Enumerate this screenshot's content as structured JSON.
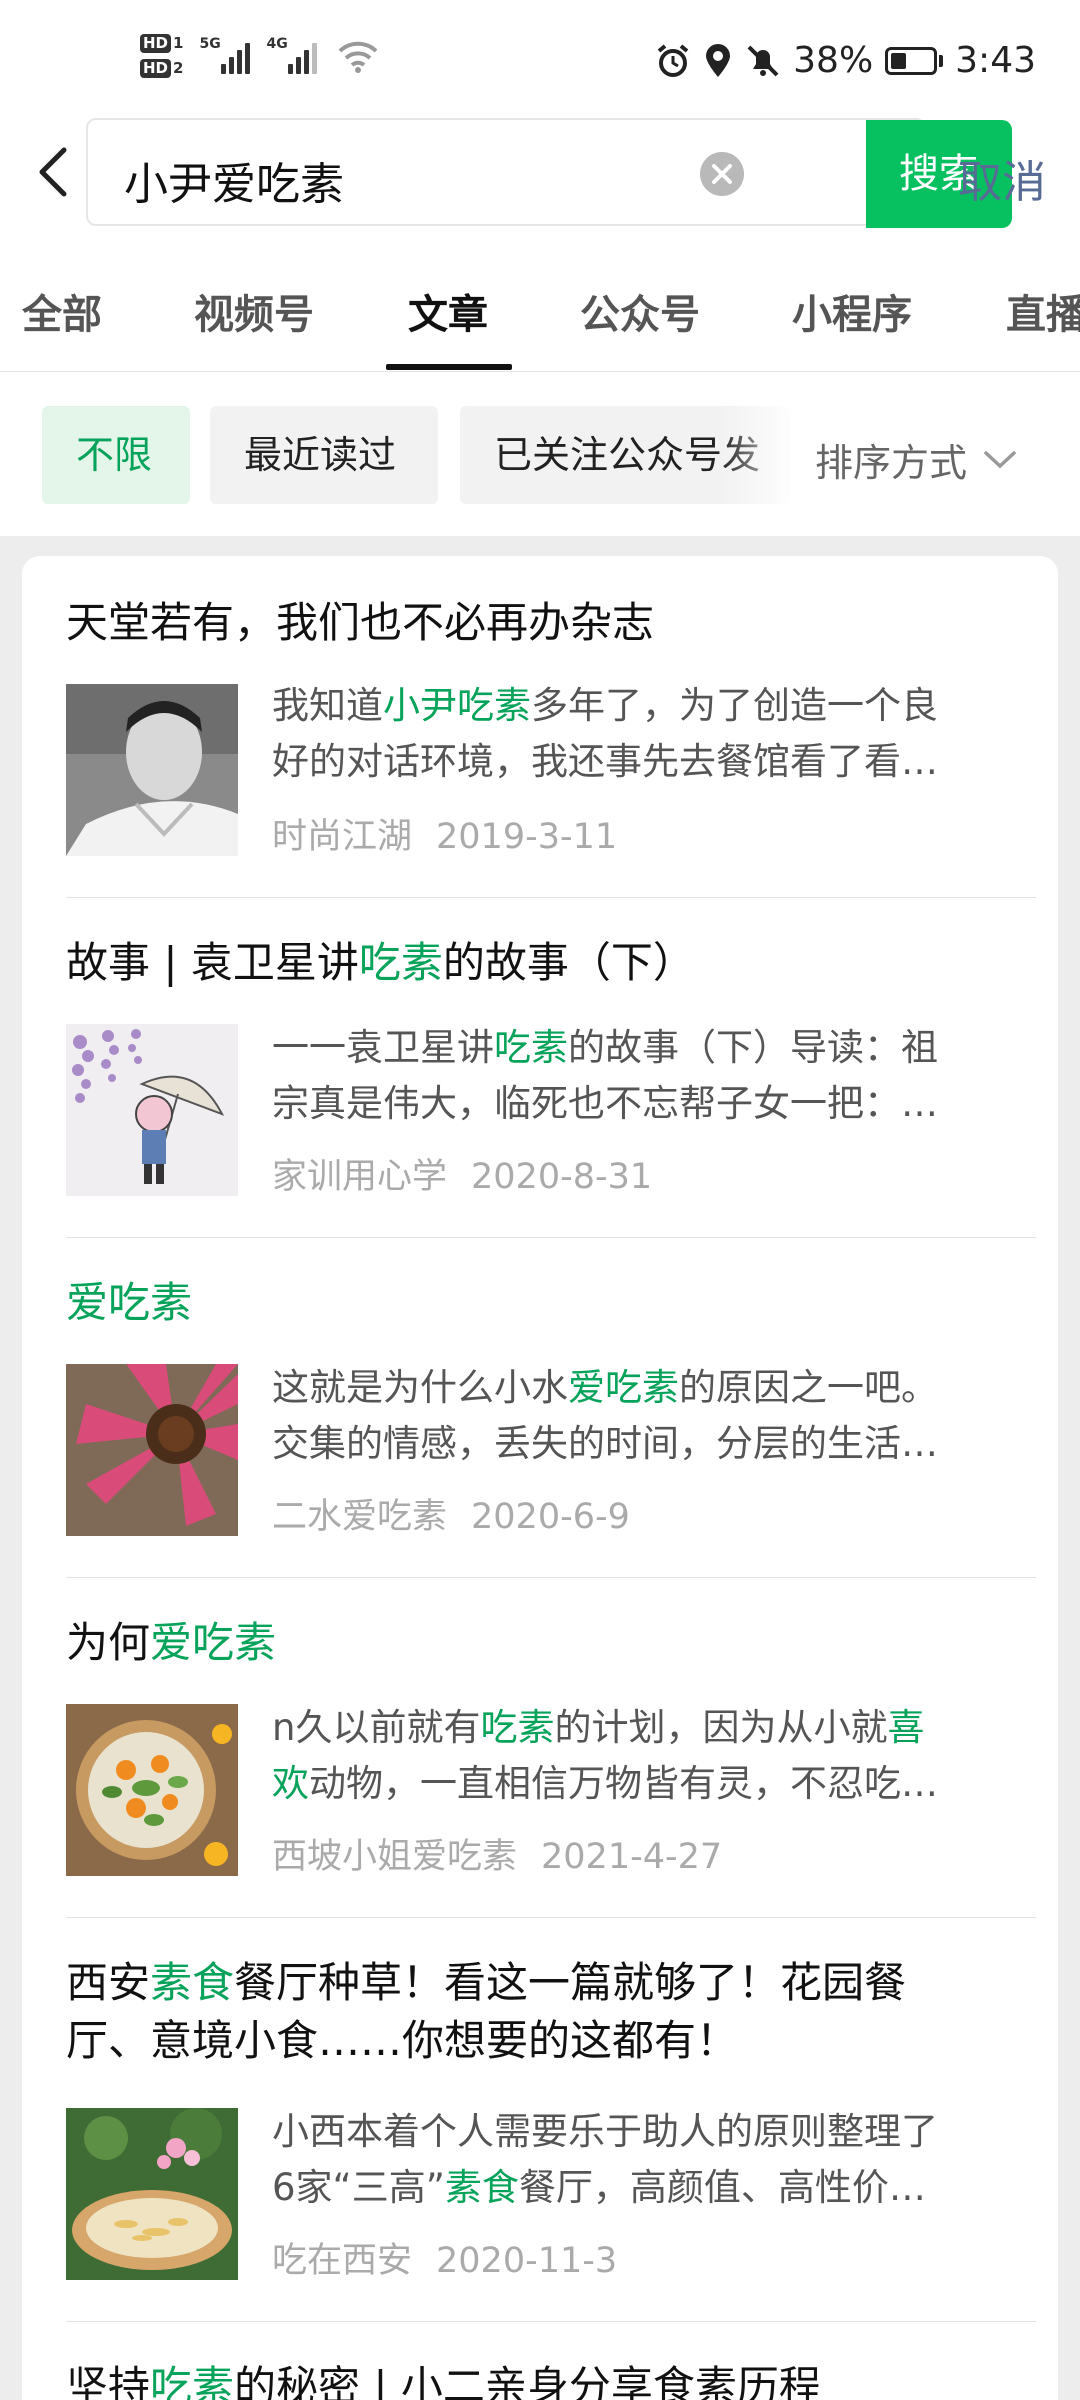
{
  "status_bar": {
    "sim1": "1",
    "sim2": "2",
    "hd": "HD",
    "net1": "5G",
    "net2": "4G",
    "battery": "38%",
    "time": "3:43",
    "icons": [
      "alarm-icon",
      "location-icon",
      "mute-icon",
      "battery-icon"
    ]
  },
  "search": {
    "query": "小尹爱吃素",
    "search_button": "搜索",
    "cancel": "取消"
  },
  "tabs": [
    "全部",
    "视频号",
    "文章",
    "公众号",
    "小程序",
    "直播"
  ],
  "active_tab": "文章",
  "filters": {
    "chips": [
      "不限",
      "最近读过",
      "已关注公众号发"
    ],
    "active_chip": "不限",
    "sort_label": "排序方式"
  },
  "results": [
    {
      "title": [
        {
          "t": "天堂若有，我们也不必再办杂志",
          "hl": false
        }
      ],
      "snippet_line1": [
        {
          "t": "我知道",
          "hl": false
        },
        {
          "t": "小尹吃素",
          "hl": true
        },
        {
          "t": "多年了，为了创造一个良",
          "hl": false
        }
      ],
      "snippet_line2": [
        {
          "t": "好的对话环境，我还事先去餐馆看了看…",
          "hl": false
        }
      ],
      "source": "时尚江湖",
      "date": "2019-3-11",
      "thumb": "portrait-photo"
    },
    {
      "title": [
        {
          "t": "故事 | 袁卫星讲",
          "hl": false
        },
        {
          "t": "吃素",
          "hl": true
        },
        {
          "t": "的故事（下）",
          "hl": false
        }
      ],
      "snippet_line1": [
        {
          "t": "一一袁卫星讲",
          "hl": false
        },
        {
          "t": "吃素",
          "hl": true
        },
        {
          "t": "的故事（下）导读：祖",
          "hl": false
        }
      ],
      "snippet_line2": [
        {
          "t": "宗真是伟大，临死也不忘帮子女一把：…",
          "hl": false
        }
      ],
      "source": "家训用心学",
      "date": "2020-8-31",
      "thumb": "wisteria-illustration"
    },
    {
      "title": [
        {
          "t": "爱吃素",
          "hl": true
        }
      ],
      "snippet_line1": [
        {
          "t": "这就是为什么小水",
          "hl": false
        },
        {
          "t": "爱吃素",
          "hl": true
        },
        {
          "t": "的原因之一吧。",
          "hl": false
        }
      ],
      "snippet_line2": [
        {
          "t": "交集的情感，丢失的时间，分层的生活…",
          "hl": false
        }
      ],
      "source": "二水爱吃素",
      "date": "2020-6-9",
      "thumb": "pink-flower-photo"
    },
    {
      "title": [
        {
          "t": "为何",
          "hl": false
        },
        {
          "t": "爱吃素",
          "hl": true
        }
      ],
      "snippet_line1": [
        {
          "t": "n久以前就有",
          "hl": false
        },
        {
          "t": "吃素",
          "hl": true
        },
        {
          "t": "的计划，因为从小就",
          "hl": false
        },
        {
          "t": "喜",
          "hl": true
        }
      ],
      "snippet_line2": [
        {
          "t": "欢",
          "hl": true
        },
        {
          "t": "动物，一直相信万物皆有灵，不忍吃…",
          "hl": false
        }
      ],
      "source": "西坡小姐爱吃素",
      "date": "2021-4-27",
      "thumb": "salad-bowl-photo"
    },
    {
      "title": [
        {
          "t": "西安",
          "hl": false
        },
        {
          "t": "素食",
          "hl": true
        },
        {
          "t": "餐厅种草！看这一篇就够了！花园餐",
          "hl": false
        }
      ],
      "title_line2": [
        {
          "t": "厅、意境小食……你想要的这都有！",
          "hl": false
        }
      ],
      "snippet_line1": [
        {
          "t": "小西本着个人需要乐于助人的原则整理了",
          "hl": false
        }
      ],
      "snippet_line2": [
        {
          "t": "6家“三高”",
          "hl": false
        },
        {
          "t": "素食",
          "hl": true
        },
        {
          "t": "餐厅，高颜值、高性价…",
          "hl": false
        }
      ],
      "source": "吃在西安",
      "date": "2020-11-3",
      "thumb": "hotpot-photo"
    },
    {
      "title": [
        {
          "t": "坚持",
          "hl": false
        },
        {
          "t": "吃素",
          "hl": true
        },
        {
          "t": "的秘密 | 小二亲身分享食素历程",
          "hl": false
        }
      ]
    }
  ]
}
